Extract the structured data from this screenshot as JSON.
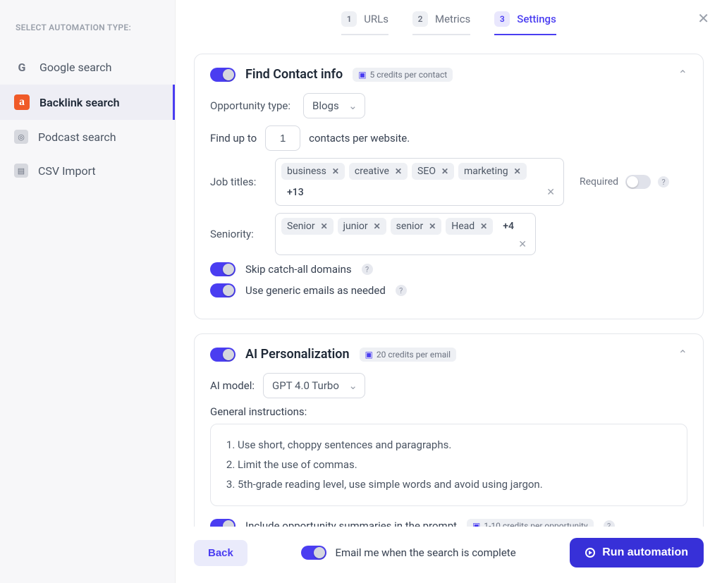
{
  "sidebar": {
    "header": "SELECT AUTOMATION TYPE:",
    "items": [
      {
        "label": "Google search"
      },
      {
        "label": "Backlink search"
      },
      {
        "label": "Podcast search"
      },
      {
        "label": "CSV Import"
      }
    ]
  },
  "stepper": {
    "step1": {
      "num": "1",
      "label": "URLs"
    },
    "step2": {
      "num": "2",
      "label": "Metrics"
    },
    "step3": {
      "num": "3",
      "label": "Settings"
    }
  },
  "contact": {
    "title": "Find Contact info",
    "credit": "5 credits per contact",
    "opp_label": "Opportunity type:",
    "opp_value": "Blogs",
    "find_up_to": "Find up to",
    "contacts_per": "contacts per website.",
    "contacts_value": "1",
    "job_label": "Job titles:",
    "job_chips": {
      "c0": "business",
      "c1": "creative",
      "c2": "SEO",
      "c3": "marketing",
      "more": "+13"
    },
    "required": "Required",
    "seniority_label": "Seniority:",
    "seniority_chips": {
      "c0": "Senior",
      "c1": "junior",
      "c2": "senior",
      "c3": "Head",
      "more": "+4"
    },
    "skip_catch": "Skip catch-all domains",
    "generic_emails": "Use generic emails as needed"
  },
  "ai": {
    "title": "AI Personalization",
    "credit": "20 credits per email",
    "model_label": "AI model:",
    "model_value": "GPT 4.0 Turbo",
    "instructions_label": "General instructions:",
    "inst1": "Use short, choppy sentences and paragraphs.",
    "inst2": "Limit the use of commas.",
    "inst3": "5th-grade reading level, use simple words and avoid using jargon.",
    "opp_summary": "Include opportunity summaries in the prompt",
    "opp_credit": "1-10 credits per opportunity"
  },
  "footer": {
    "back": "Back",
    "email_me": "Email me when the search is complete",
    "run": "Run automation"
  }
}
